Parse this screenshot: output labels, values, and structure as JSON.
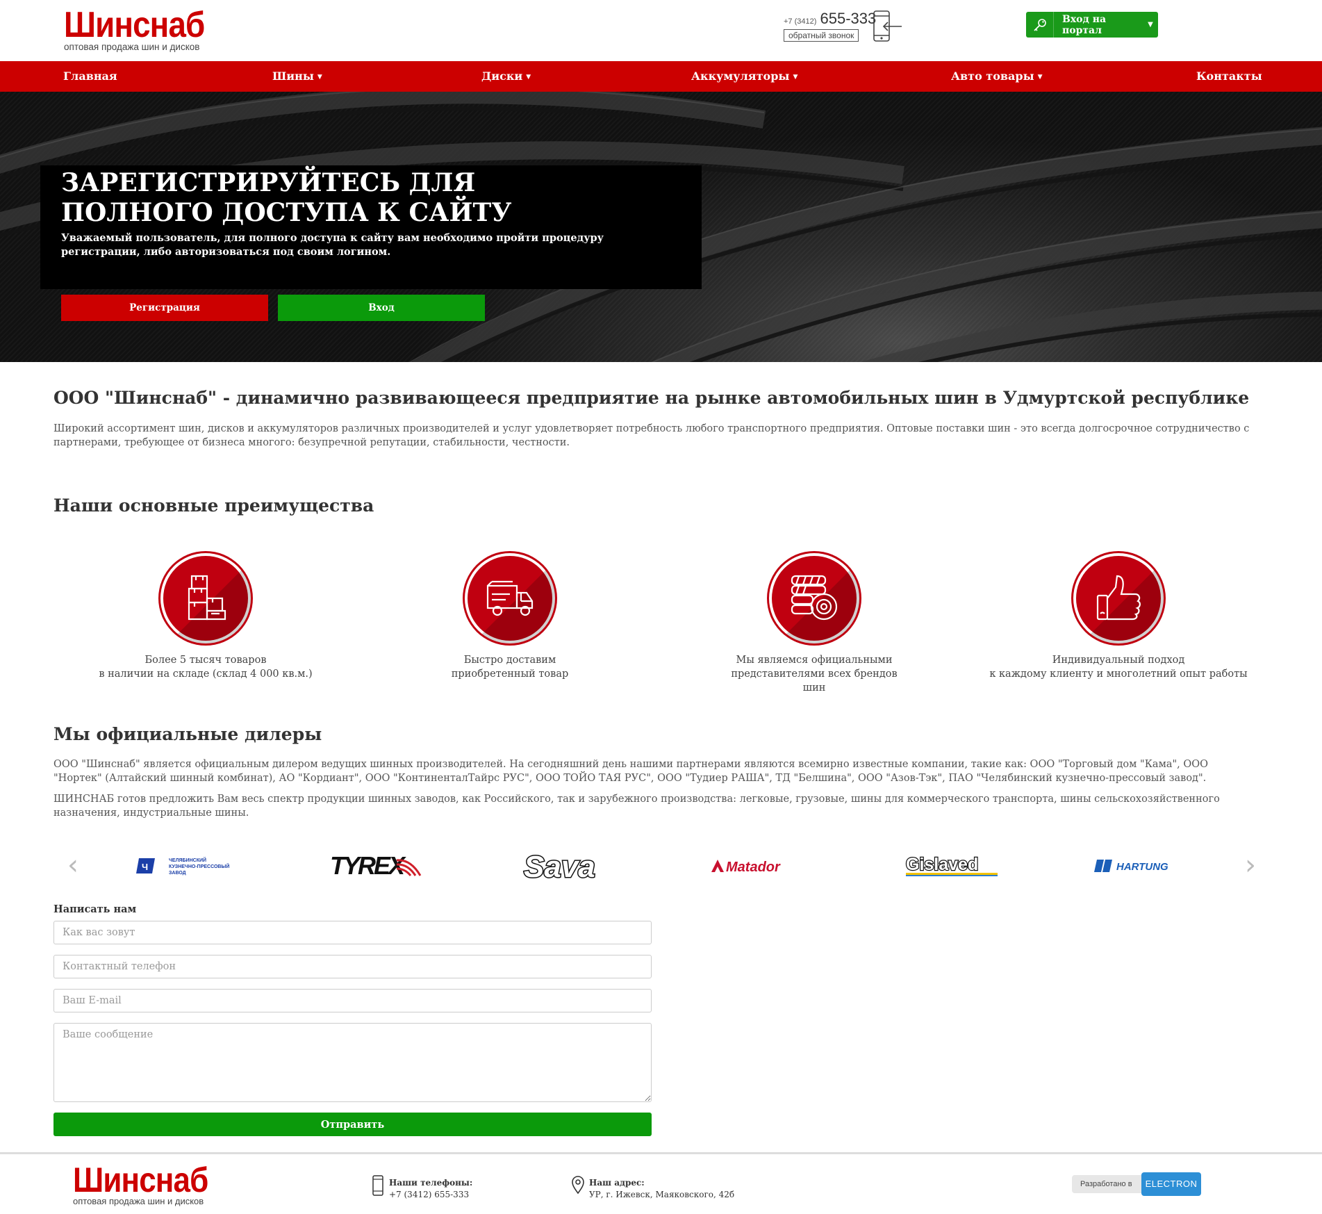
{
  "header": {
    "logo_name": "Шинснаб",
    "logo_tagline": "оптовая продажа шин и дисков",
    "phone_prefix": "+7 (3412)",
    "phone_number": "655-333",
    "callback_label": "обратный звонок",
    "portal_button_label": "Вход на портал"
  },
  "nav": {
    "items": [
      {
        "label": "Главная",
        "has_dropdown": false
      },
      {
        "label": "Шины",
        "has_dropdown": true
      },
      {
        "label": "Диски",
        "has_dropdown": true
      },
      {
        "label": "Аккумуляторы",
        "has_dropdown": true
      },
      {
        "label": "Авто товары",
        "has_dropdown": true
      },
      {
        "label": "Контакты",
        "has_dropdown": false
      }
    ]
  },
  "hero": {
    "title_line1": "ЗАРЕГИСТРИРУЙТЕСЬ ДЛЯ",
    "title_line2": "ПОЛНОГО ДОСТУПА К САЙТУ",
    "text": "Уважаемый пользователь, для полного доступа к сайту вам необходимо пройти процедуру регистрации, либо авторизоваться под своим логином.",
    "register_label": "Регистрация",
    "login_label": "Вход"
  },
  "about": {
    "title": "ООО \"Шинснаб\" - динамично развивающееся предприятие на рынке автомобильных шин в Удмуртской республике",
    "text": "Широкий ассортимент шин, дисков и аккумуляторов различных производителей и услуг удовлетворяет потребность любого транспортного предприятия. Оптовые поставки шин - это всегда долгосрочное сотрудничество с партнерами, требующее от бизнеса многого: безупречной репутации, стабильности, честности."
  },
  "advantages": {
    "title": "Наши основные преимущества",
    "items": [
      {
        "icon": "warehouse-boxes-icon",
        "line1": "Более 5 тысяч товаров",
        "line2": "в наличии на складе (склад 4 000 кв.м.)",
        "line3": ""
      },
      {
        "icon": "delivery-truck-icon",
        "line1": "Быстро доставим",
        "line2": "приобретенный товар",
        "line3": ""
      },
      {
        "icon": "tires-stack-icon",
        "line1": "Мы являемся официальными",
        "line2": "представителями всех брендов",
        "line3": "шин"
      },
      {
        "icon": "thumbs-up-icon",
        "line1": "Индивидуальный подход",
        "line2": "к каждому клиенту и многолетний опыт работы",
        "line3": ""
      }
    ]
  },
  "dealers": {
    "title": "Мы официальные дилеры",
    "paragraph1": "ООО \"Шинснаб\" является официальным дилером ведущих шинных производителей. На сегодняшний день нашими партнерами являются всемирно известные компании, такие как: ООО \"Торговый дом \"Кама\", ООО \"Нортек\" (Алтайский шинный комбинат), АО \"Кордиант\", ООО \"КонтиненталТайрс РУС\", ООО ТОЙО ТАЯ РУС\", ООО \"Тудиер РАША\", ТД \"Белшина\", ООО \"Азов-Тэк\", ПАО \"Челябинский кузнечно-прессовый завод\".",
    "paragraph2": "ШИНСНАБ готов предложить Вам весь спектр продукции шинных заводов, как Российского, так и зарубежного производства: легковые, грузовые, шины для коммерческого транспорта, шины сельскохозяйственного назначения, индустриальные шины.",
    "brands": [
      {
        "name": "ЧЕЛЯБИНСКИЙ КУЗНЕЧНО-ПРЕССОВЫЙ ЗАВОД",
        "line1": "ЧЕЛЯБИНСКИЙ",
        "line2": "КУЗНЕЧНО-ПРЕССОВЫЙ",
        "line3": "ЗАВОД",
        "color": "#1b3fa8"
      },
      {
        "name": "TYREX",
        "color": "#111111",
        "accent": "#d01f2a"
      },
      {
        "name": "Sava",
        "color": "#111111"
      },
      {
        "name": "Matador",
        "color": "#c8102e"
      },
      {
        "name": "Gislaved",
        "color": "#111111",
        "accent": "#f3c300"
      },
      {
        "name": "HARTUNG",
        "color": "#1b5fb8"
      }
    ]
  },
  "contact_form": {
    "title": "Написать нам",
    "name_placeholder": "Как вас зовут",
    "phone_placeholder": "Контактный телефон",
    "email_placeholder": "Ваш E-mail",
    "message_placeholder": "Ваше сообщение",
    "submit_label": "Отправить"
  },
  "footer": {
    "phones_label": "Наши телефоны:",
    "phone": "+7 (3412) 655-333",
    "address_label": "Наш адрес:",
    "address": "УР, г. Ижевск, Маяковского, 42б",
    "developer_label": "Разработано в",
    "developer_name": "ELECTRON"
  },
  "colors": {
    "brand_red": "#cc0000",
    "brand_green": "#0b9a0b",
    "hero_box": "#000000"
  }
}
